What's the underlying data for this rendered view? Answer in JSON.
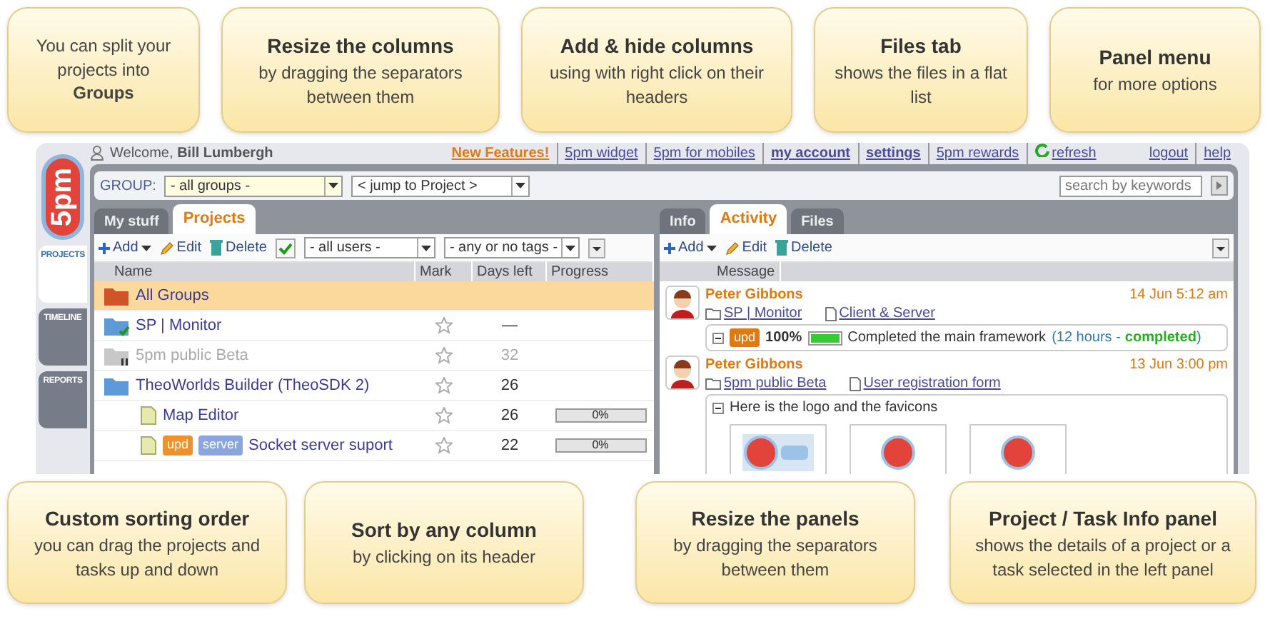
{
  "callouts_top": [
    {
      "kind": "plain",
      "text": "You can split your projects into **Groups**"
    },
    {
      "kind": "titled",
      "title": "Resize the columns",
      "text": "by dragging the separators between them"
    },
    {
      "kind": "titled",
      "title": "Add & hide columns",
      "text": "using with right click on their headers"
    },
    {
      "kind": "titled",
      "title": "Files tab",
      "text": "shows the files in a flat list"
    },
    {
      "kind": "titled",
      "title": "Panel menu",
      "text": "for more options"
    }
  ],
  "app": {
    "logo": "5pm",
    "side_tabs": [
      {
        "label": "PROJECTS",
        "selected": true
      },
      {
        "label": "TIMELINE",
        "selected": false
      },
      {
        "label": "REPORTS",
        "selected": false
      }
    ],
    "welcome": "Welcome, **Bill Lumbergh**",
    "top_links": [
      {
        "label": "New Features!",
        "kind": "highlight"
      },
      {
        "label": "5pm widget",
        "kind": "link"
      },
      {
        "label": "5pm for mobiles",
        "kind": "link"
      },
      {
        "label": "my account",
        "kind": "bold"
      },
      {
        "label": "settings",
        "kind": "bold"
      },
      {
        "label": "5pm rewards",
        "kind": "link"
      },
      {
        "label": "refresh",
        "kind": "refresh"
      }
    ],
    "right_links": [
      "logout",
      "help"
    ],
    "group_label": "GROUP:",
    "group_select": "- all groups -",
    "jump_select": "< jump to Project >",
    "search": {
      "placeholder": "search by keywords"
    },
    "left_tabs": [
      {
        "label": "My stuff",
        "selected": false
      },
      {
        "label": "Projects",
        "selected": true
      }
    ],
    "right_tabs": [
      {
        "label": "Info",
        "selected": false
      },
      {
        "label": "Activity",
        "selected": true
      },
      {
        "label": "Files",
        "selected": false
      }
    ],
    "left_toolbar": {
      "add": "Add",
      "edit": "Edit",
      "delete": "Delete",
      "users_filter": "- all users -",
      "tags_filter": "- any or no tags -"
    },
    "columns": [
      "Name",
      "Mark",
      "Days left",
      "Progress"
    ],
    "rows": [
      {
        "kind": "group",
        "name": "All Groups",
        "selected": true
      },
      {
        "kind": "project",
        "name": "SP | Monitor",
        "completed": true,
        "paused": false,
        "days": "—",
        "selected": false
      },
      {
        "kind": "project",
        "name": "5pm public Beta",
        "completed": false,
        "paused": true,
        "days": "32",
        "selected": false
      },
      {
        "kind": "project",
        "name": "TheoWorlds Builder (TheoSDK 2)",
        "completed": false,
        "paused": false,
        "days": "26",
        "selected": false,
        "children": [
          {
            "kind": "task",
            "name": "Map Editor",
            "days": "26",
            "progress": "0%",
            "level": 0,
            "selected": false
          },
          {
            "kind": "task",
            "name": "Socket server suport",
            "tags": [
              {
                "label": "upd",
                "color": "#f0922c"
              },
              {
                "label": "server",
                "color": "#8aa6dc"
              }
            ],
            "days": "22",
            "progress": "0%",
            "level": 0,
            "selected": false
          }
        ]
      }
    ],
    "right_toolbar": {
      "add": "Add",
      "edit": "Edit",
      "delete": "Delete"
    },
    "message_column": "Message",
    "activity": [
      {
        "kind": "progress",
        "author": "Peter Gibbons",
        "time": "14 Jun 5:12 am",
        "project": "SP | Monitor",
        "task": "Client & Server",
        "tag": "upd",
        "percent": "100%",
        "level": 1,
        "text": "Completed the main framework",
        "note": "(12 hours -",
        "status": "completed",
        "note_end": ")"
      },
      {
        "kind": "attachments",
        "author": "Peter Gibbons",
        "time": "13 Jun 3:00 pm",
        "project": "5pm public Beta",
        "task": "User registration form",
        "text": "Here is the logo and the favicons",
        "attachments": [
          {
            "kind": "logo"
          },
          {
            "kind": "favicon"
          },
          {
            "kind": "favicon"
          }
        ]
      }
    ]
  },
  "callouts_bottom": [
    {
      "kind": "titled",
      "title": "Custom sorting order",
      "text": "you can drag the projects and tasks up and down"
    },
    {
      "kind": "titled",
      "title": "Sort by any column",
      "text": "by clicking on its header"
    },
    {
      "kind": "titled",
      "title": "Resize the panels",
      "text": "by dragging the separators between them"
    },
    {
      "kind": "titled",
      "title": "Project / Task Info panel",
      "text": "shows the details of a project or a task selected in the left panel"
    }
  ]
}
